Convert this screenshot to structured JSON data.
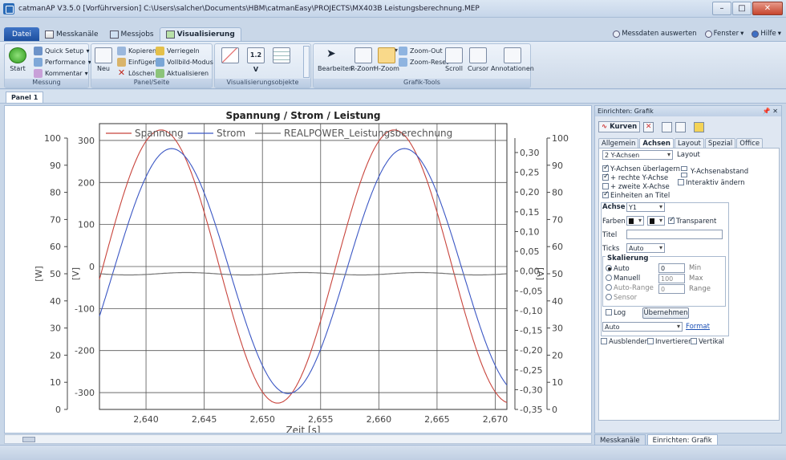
{
  "titlebar": {
    "title": "catmanAP V3.5.0 [Vorführversion]  C:\\Users\\salcher\\Documents\\HBM\\catmanEasy\\PROJECTS\\MX403B Leistungsberechnung.MEP"
  },
  "tabs": [
    {
      "label": "Datei"
    },
    {
      "label": "Messkanäle"
    },
    {
      "label": "Messjobs"
    },
    {
      "label": "Visualisierung"
    }
  ],
  "top_links": {
    "messdaten": "Messdaten auswerten",
    "fenster": "Fenster",
    "hilfe": "Hilfe"
  },
  "ribbon": {
    "messung": {
      "label": "Messung",
      "start": "Start",
      "quick_setup": "Quick Setup",
      "performance": "Performance",
      "kommentar": "Kommentar"
    },
    "panel": {
      "label": "Panel/Seite",
      "neu": "Neu",
      "kopieren": "Kopieren",
      "einfuegen": "Einfügen",
      "loeschen": "Löschen",
      "verriegeln": "Verriegeln",
      "vollbild": "Vollbild-Modus",
      "aktualisieren": "Aktualisieren"
    },
    "vis": {
      "label": "Visualisierungsobjekte",
      "value_display": "1.2 V"
    },
    "tools": {
      "label": "Grafik-Tools",
      "bearbeiten": "Bearbeiten",
      "rzoom": "R-Zoom",
      "hzoom": "H-Zoom",
      "zoom_out": "Zoom-Out",
      "zoom_reset": "Zoom-Reset",
      "scroll": "Scroll",
      "cursor": "Cursor",
      "annotationen": "Annotationen"
    }
  },
  "panel_tab": "Panel 1",
  "chart_data": {
    "type": "line",
    "title": "Spannung / Strom / Leistung",
    "xlabel": "Zeit [s]",
    "xlim": [
      2.636,
      2.671
    ],
    "x_ticks": [
      "2,640",
      "2,645",
      "2,650",
      "2,655",
      "2,660",
      "2,665",
      "2,670"
    ],
    "axes": [
      {
        "label": "[W]",
        "ticks": [
          "100",
          "90",
          "80",
          "70",
          "60",
          "50",
          "40",
          "30",
          "20",
          "10",
          "0"
        ]
      },
      {
        "label": "[V]",
        "ticks": [
          "300",
          "200",
          "100",
          "0",
          "-100",
          "-200",
          "-300"
        ]
      },
      {
        "label": "[A]",
        "ticks": [
          "0,30",
          "0,25",
          "0,20",
          "0,15",
          "0,10",
          "0,05",
          "0,00",
          "-0,05",
          "-0,10",
          "-0,15",
          "-0,20",
          "-0,25",
          "-0,30",
          "-0,35"
        ]
      },
      {
        "label": "",
        "ticks": [
          "100",
          "90",
          "80",
          "70",
          "60",
          "50",
          "40",
          "30",
          "20",
          "10",
          "0"
        ]
      }
    ],
    "series": [
      {
        "name": "Spannung",
        "color": "#c8443c",
        "axis": "V",
        "amplitude": 325,
        "period": 0.02,
        "phase_zero_cross": 2.6363
      },
      {
        "name": "Strom",
        "color": "#3b57c4",
        "axis": "A",
        "amplitude": 0.31,
        "period": 0.02,
        "phase_zero_cross": 2.6372
      },
      {
        "name": "REALPOWER_Leistungsberechnung",
        "color": "#777777",
        "axis": "W",
        "value": 50
      }
    ],
    "grid": true,
    "legend": "top"
  },
  "right_panel": {
    "header": "Einrichten: Grafik",
    "kurven": "Kurven",
    "tabs": [
      "Allgemein",
      "Achsen",
      "Layout",
      "Spezial",
      "Office"
    ],
    "y_axes_select": "2 Y-Achsen",
    "layout_label": "Layout",
    "ueberlagern": "Y-Achsen überlagern",
    "rechte": "+ rechte Y-Achse",
    "zweite_x": "+ zweite X-Achse",
    "einheiten": "Einheiten an Titel",
    "abstand": "Y-Achsenabstand",
    "interaktiv": "Interaktiv ändern",
    "achse_label": "Achse",
    "achse_value": "Y1",
    "farben": "Farben",
    "transparent": "Transparent",
    "titel": "Titel",
    "ticks": "Ticks",
    "ticks_value": "Auto",
    "skalierung": "Skalierung",
    "auto": "Auto",
    "manuell": "Manuell",
    "auto_range": "Auto-Range",
    "sensor": "Sensor",
    "log": "Log",
    "min_value": "0",
    "max_value": "100",
    "range_value": "0",
    "min_label": "Min",
    "max_label": "Max",
    "range_label": "Range",
    "uebernehmen": "Übernehmen",
    "format_select": "Auto",
    "format_link": "Format",
    "ausblenden": "Ausblenden",
    "invertieren": "Invertieren",
    "vertikal": "Vertikal"
  },
  "bottom_tabs": [
    "Messkanäle",
    "Einrichten: Grafik"
  ]
}
